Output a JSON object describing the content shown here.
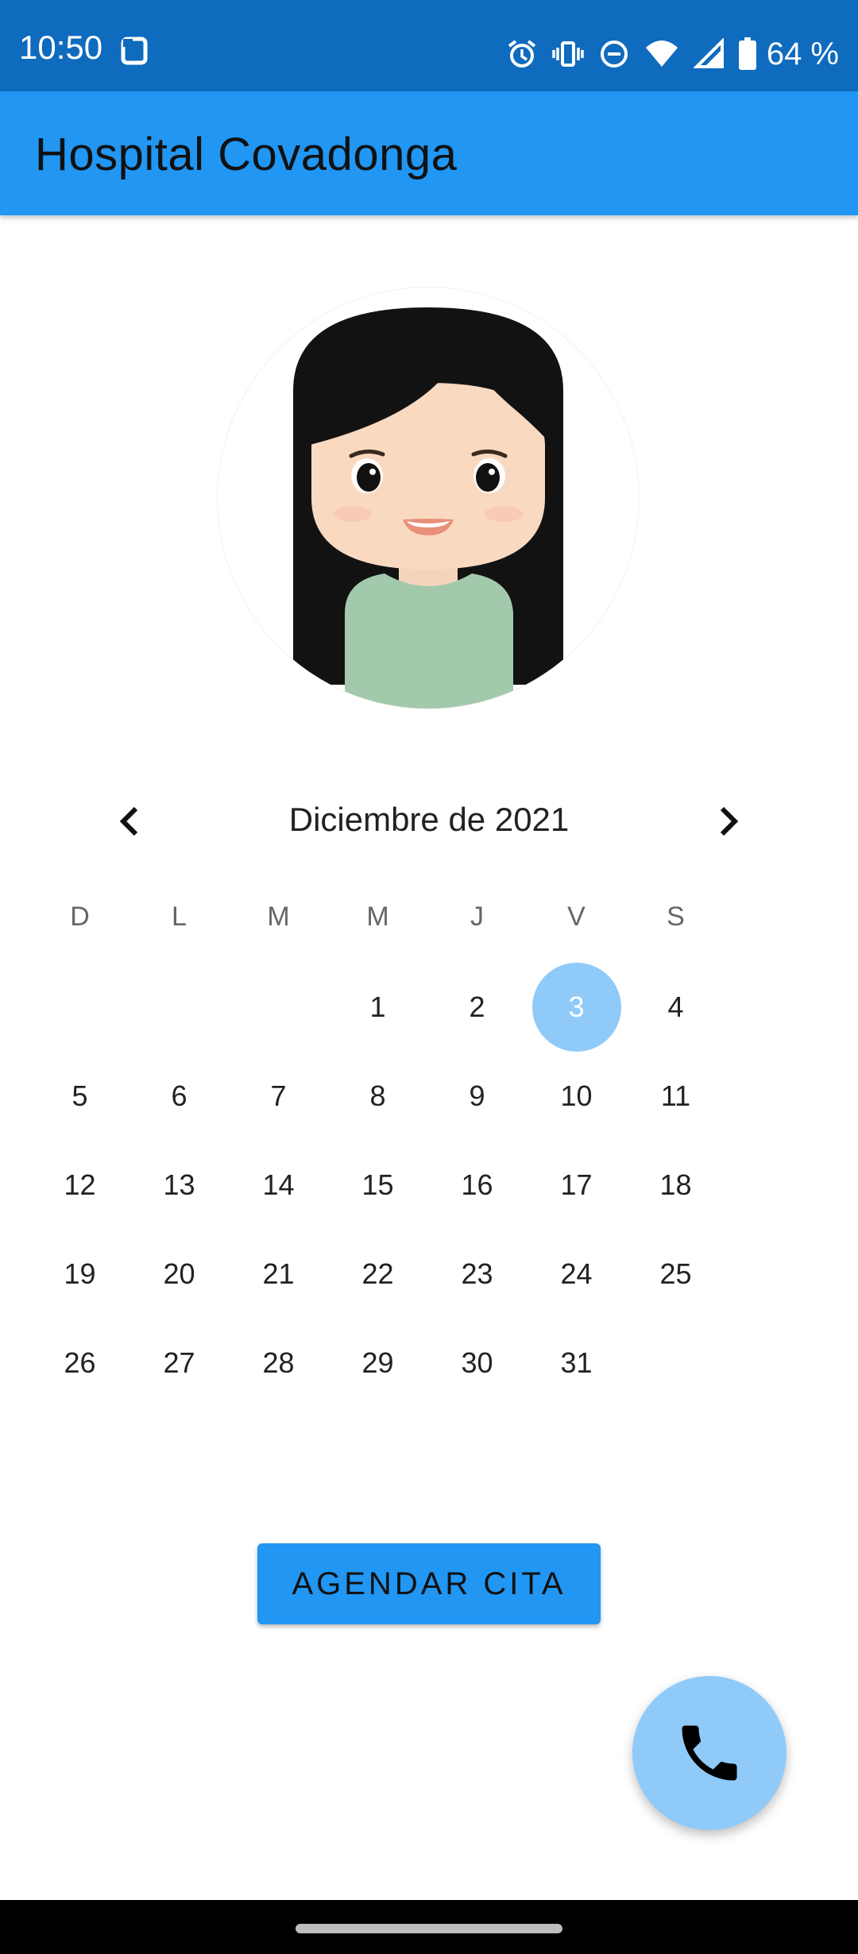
{
  "status_bar": {
    "time": "10:50",
    "battery": "64 %",
    "icons": [
      "screenshot-icon",
      "alarm-icon",
      "vibrate-icon",
      "do-not-disturb-icon",
      "wifi-icon",
      "signal-icon",
      "battery-icon"
    ]
  },
  "app_bar": {
    "title": "Hospital Covadonga"
  },
  "calendar": {
    "month_title": "Diciembre de 2021",
    "weekdays": [
      "D",
      "L",
      "M",
      "M",
      "J",
      "V",
      "S"
    ],
    "days": [
      "",
      "",
      "",
      "1",
      "2",
      "3",
      "4",
      "5",
      "6",
      "7",
      "8",
      "9",
      "10",
      "11",
      "12",
      "13",
      "14",
      "15",
      "16",
      "17",
      "18",
      "19",
      "20",
      "21",
      "22",
      "23",
      "24",
      "25",
      "26",
      "27",
      "28",
      "29",
      "30",
      "31",
      ""
    ],
    "selected_day": "3"
  },
  "actions": {
    "schedule_button": "AGENDAR CITA"
  },
  "colors": {
    "status_bar": "#0f6bbd",
    "app_bar": "#2196f3",
    "selection": "#90caf9",
    "button": "#2196f3",
    "fab": "#90caf9"
  }
}
